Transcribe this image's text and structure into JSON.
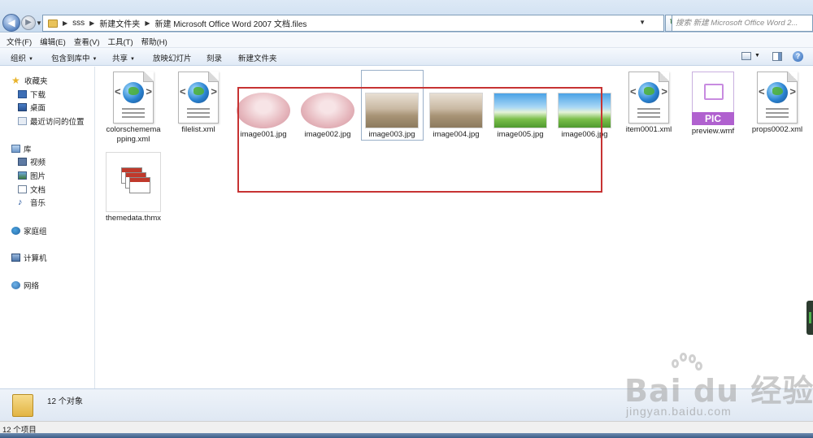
{
  "address": {
    "crumbs": [
      "sss",
      "新建文件夹",
      "新建 Microsoft Office Word 2007 文档.files"
    ],
    "search_placeholder": "搜索 新建 Microsoft Office Word 2..."
  },
  "menu": [
    "文件(F)",
    "编辑(E)",
    "查看(V)",
    "工具(T)",
    "帮助(H)"
  ],
  "commands": {
    "organize": "组织",
    "include_in_library": "包含到库中",
    "share": "共享",
    "slideshow": "放映幻灯片",
    "burn": "刻录",
    "new_folder": "新建文件夹"
  },
  "nav": {
    "favorites": "收藏夹",
    "downloads": "下载",
    "desktop": "桌面",
    "recent": "最近访问的位置",
    "libraries": "库",
    "videos": "视频",
    "pictures": "图片",
    "documents": "文档",
    "music": "音乐",
    "homegroup": "家庭组",
    "computer": "计算机",
    "network": "网络"
  },
  "files": [
    {
      "name": "colorschememapping.xml",
      "icon": "xml-globe-icon"
    },
    {
      "name": "filelist.xml",
      "icon": "xml-globe-icon"
    },
    {
      "name": "image001.jpg",
      "icon": "photo-thumbnail"
    },
    {
      "name": "image002.jpg",
      "icon": "photo-thumbnail"
    },
    {
      "name": "image003.jpg",
      "icon": "photo-thumbnail"
    },
    {
      "name": "image004.jpg",
      "icon": "photo-thumbnail"
    },
    {
      "name": "image005.jpg",
      "icon": "photo-thumbnail"
    },
    {
      "name": "image006.jpg",
      "icon": "photo-thumbnail"
    },
    {
      "name": "item0001.xml",
      "icon": "xml-globe-icon"
    },
    {
      "name": "preview.wmf",
      "icon": "pic-file-icon"
    },
    {
      "name": "props0002.xml",
      "icon": "xml-globe-icon"
    },
    {
      "name": "themedata.thmx",
      "icon": "theme-file-icon"
    }
  ],
  "pic_label": "PIC",
  "details": {
    "count": "12 个对象"
  },
  "status": {
    "items": "12 个项目"
  },
  "watermark": {
    "brand": "Bai du 经验",
    "url": "jingyan.baidu.com"
  }
}
